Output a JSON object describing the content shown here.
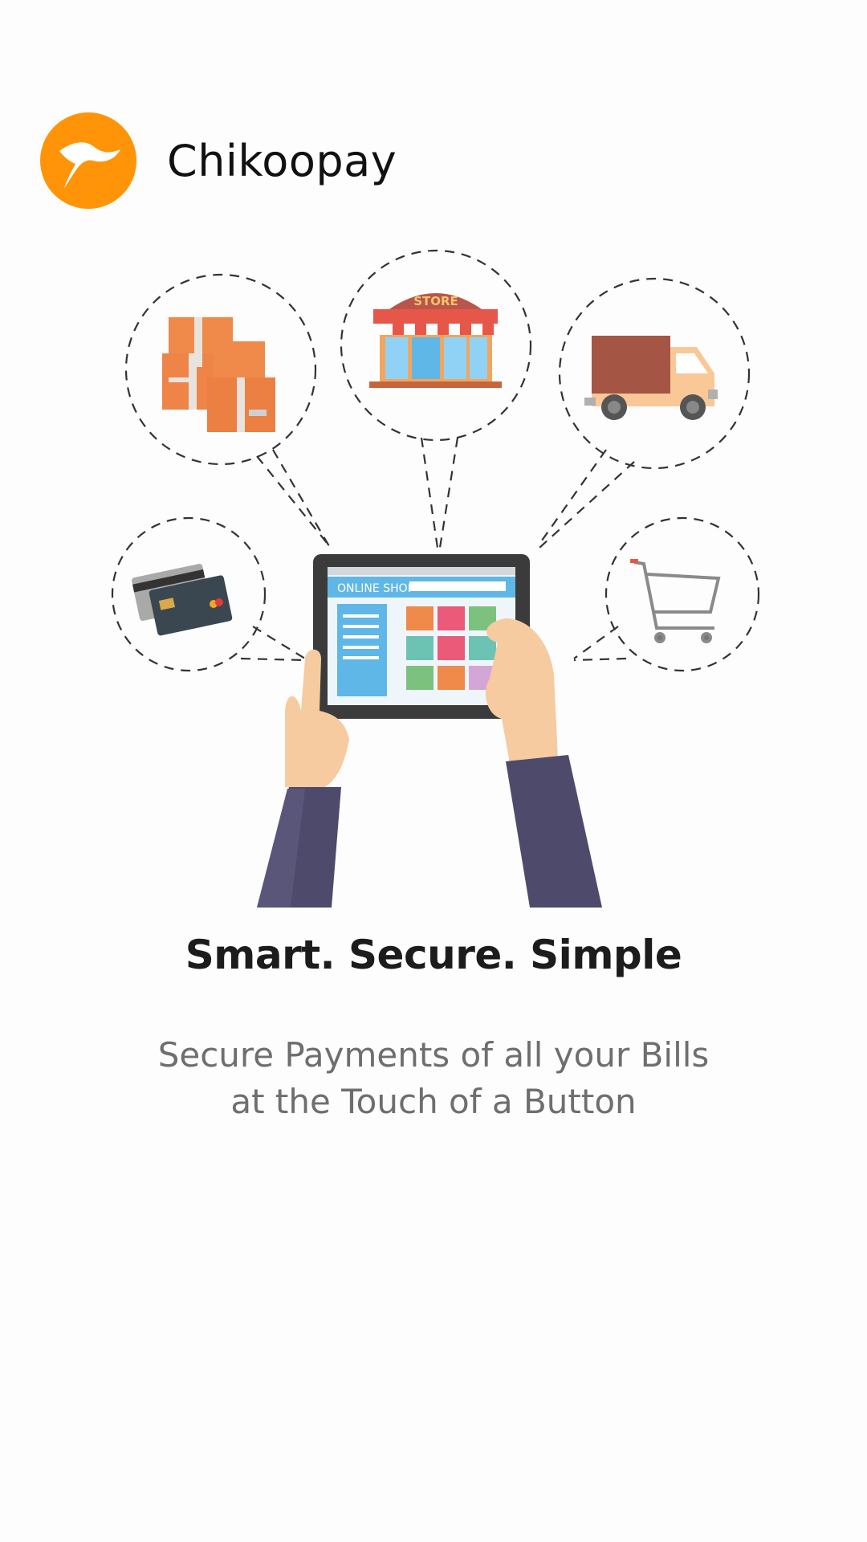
{
  "app": {
    "name": "Chikoopay"
  },
  "colors": {
    "brand_orange": "#ff9408",
    "headline": "#1c1c1c",
    "subtitle": "#6e6e6e",
    "sleeve": "#4e4a6b",
    "skin": "#f6cba0"
  },
  "icons": {
    "logo": "chikoopay-bird-logo",
    "bubbles": [
      "boxes-icon",
      "store-icon",
      "delivery-truck-icon",
      "credit-cards-icon",
      "shopping-cart-icon"
    ]
  },
  "illustration": {
    "store_sign": "STORE",
    "tablet_search_text": "ONLINE SHOP"
  },
  "onboarding": {
    "headline": "Smart. Secure. Simple",
    "subtitle_line1": "Secure Payments of all your Bills",
    "subtitle_line2": "at the Touch of a Button"
  }
}
